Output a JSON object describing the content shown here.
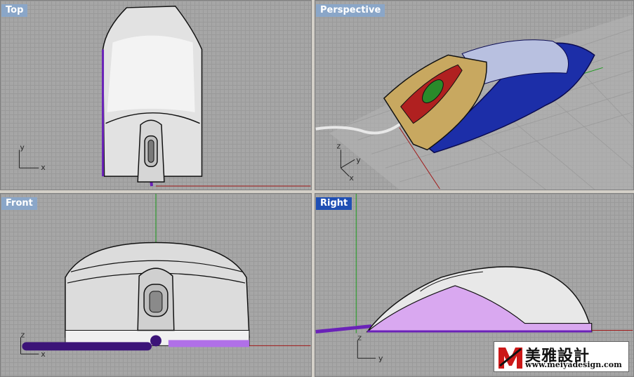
{
  "viewports": {
    "top": {
      "title": "Top",
      "axis_a": "y",
      "axis_b": "x"
    },
    "perspective": {
      "title": "Perspective",
      "axis_a": "z",
      "axis_b": "y",
      "axis_c": "x"
    },
    "front": {
      "title": "Front",
      "axis_a": "z",
      "axis_b": "x"
    },
    "right": {
      "title": "Right",
      "axis_a": "z",
      "axis_b": "y"
    }
  },
  "active_viewport": "Right",
  "watermark": {
    "brand_cn": "美雅設計",
    "url": "www.meiyadesign.com"
  },
  "colors": {
    "viewport_bg": "#a6a6a6",
    "grid": "#9a9a9a",
    "title_inactive": "#8aa6c8",
    "title_active": "#1f4fb4",
    "axis_green": "#1a9a1a",
    "axis_red": "#a01818",
    "accent_purple": "#6a22b8"
  }
}
